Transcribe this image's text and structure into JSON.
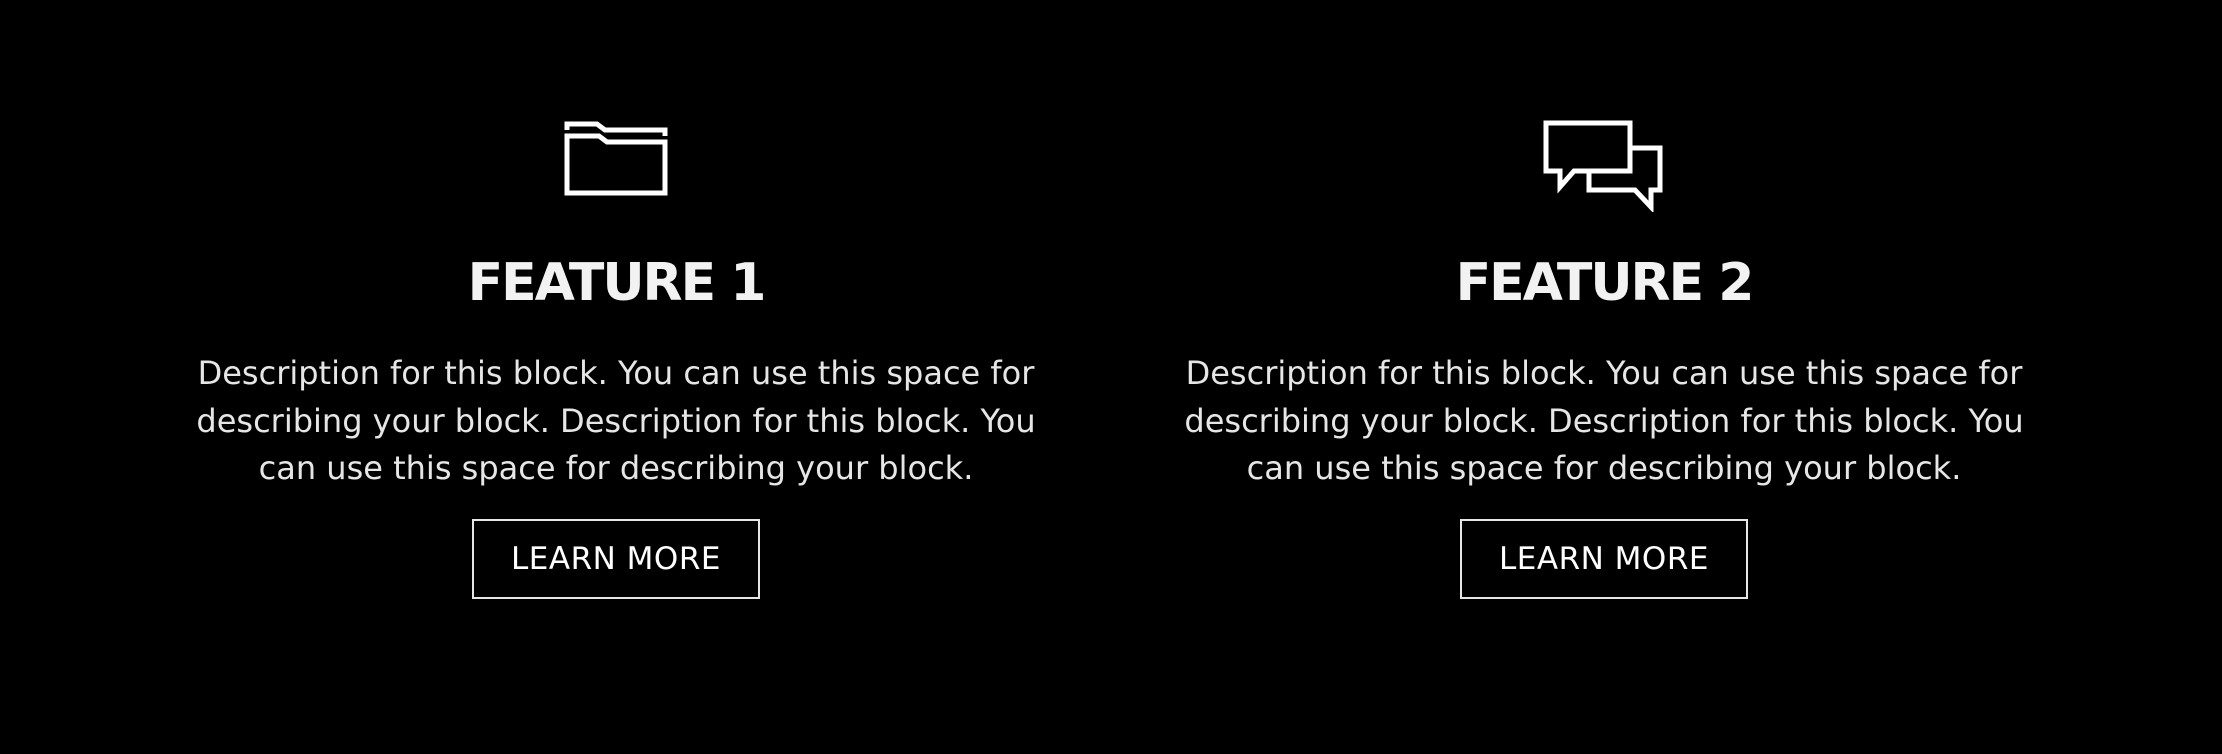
{
  "features": [
    {
      "icon": "folder-icon",
      "title": "FEATURE 1",
      "description": "Description for this block. You can use this space for describing your block. Description for this block. You can use this space for describing your block.",
      "button_label": "LEARN MORE"
    },
    {
      "icon": "chat-bubbles-icon",
      "title": "FEATURE 2",
      "description": "Description for this block. You can use this space for describing your block. Description for this block. You can use this space for describing your block.",
      "button_label": "LEARN MORE"
    }
  ],
  "colors": {
    "background": "#000000",
    "text": "#ffffff",
    "button_border": "#e6e6e6"
  }
}
